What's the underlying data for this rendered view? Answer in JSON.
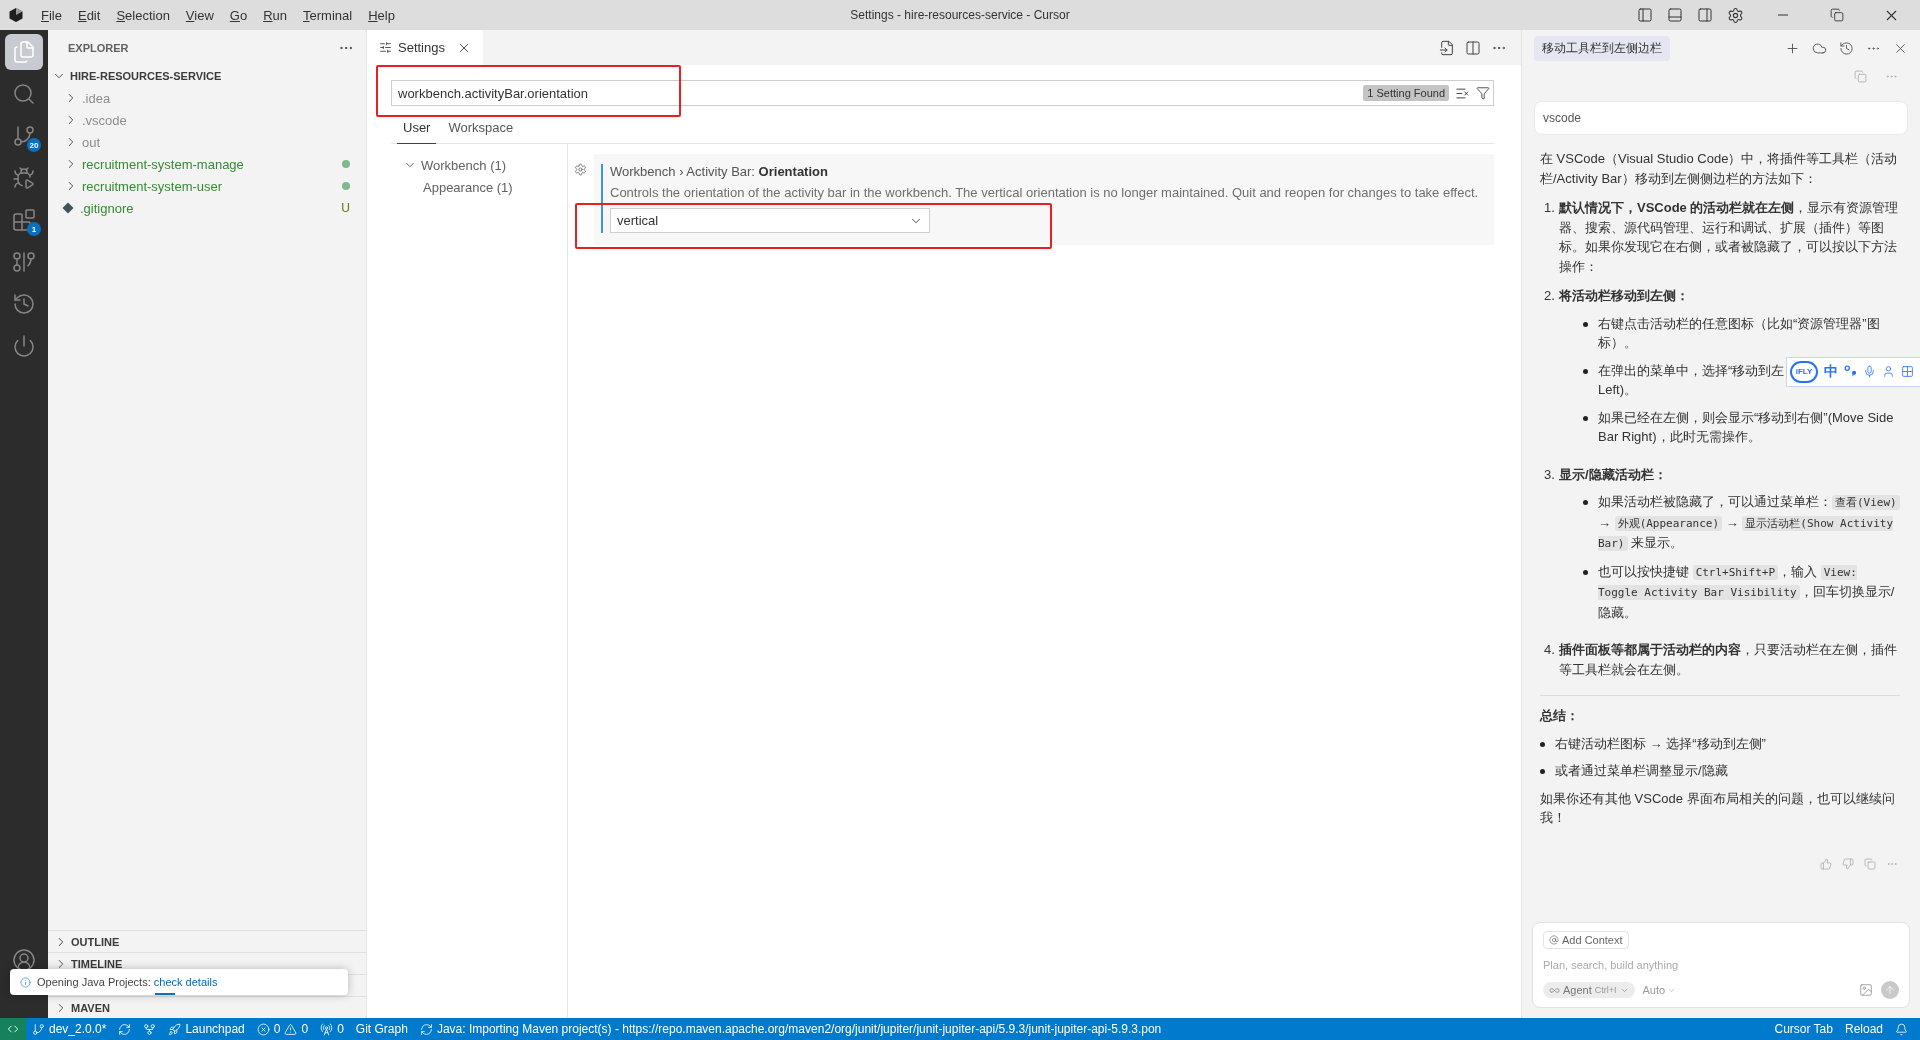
{
  "title_bar": {
    "menus": [
      "File",
      "Edit",
      "Selection",
      "View",
      "Go",
      "Run",
      "Terminal",
      "Help"
    ],
    "title": "Settings - hire-resources-service - Cursor"
  },
  "activity_bar": {
    "items": [
      {
        "kind": "explorer",
        "selected": true
      },
      {
        "kind": "search",
        "selected": false
      },
      {
        "kind": "source-control",
        "selected": false,
        "badge": "20"
      },
      {
        "kind": "run-debug",
        "selected": false
      },
      {
        "kind": "extensions",
        "selected": false,
        "badge": "1"
      },
      {
        "kind": "graph",
        "selected": false
      },
      {
        "kind": "history",
        "selected": false
      },
      {
        "kind": "power",
        "selected": false
      }
    ]
  },
  "explorer": {
    "title": "EXPLORER",
    "root": {
      "name": "HIRE-RESOURCES-SERVICE",
      "expanded": true,
      "children": [
        {
          "name": ".idea",
          "kind": "folder",
          "color": "#8e8e90",
          "expanded": false
        },
        {
          "name": ".vscode",
          "kind": "folder",
          "color": "#8e8e90",
          "expanded": false
        },
        {
          "name": "out",
          "kind": "folder",
          "color": "#8e8e90",
          "expanded": false
        },
        {
          "name": "recruitment-system-manage",
          "kind": "folder",
          "color": "#388a34",
          "expanded": false,
          "dot": true
        },
        {
          "name": "recruitment-system-user",
          "kind": "folder",
          "color": "#388a34",
          "expanded": false,
          "dot": true
        },
        {
          "name": ".gitignore",
          "kind": "file",
          "color": "#388a34",
          "badge": "U"
        }
      ]
    },
    "sections": [
      {
        "title": "OUTLINE",
        "expanded": false
      },
      {
        "title": "TIMELINE",
        "expanded": false
      },
      {
        "title": "MAVEN",
        "expanded": false
      }
    ]
  },
  "notification": {
    "message": "Opening Java Projects:",
    "link": "check details"
  },
  "editor": {
    "tabs": [
      {
        "label": "Settings",
        "selected": true
      }
    ],
    "settings": {
      "search_value": "workbench.activityBar.orientation",
      "result_count": "1 Setting Found",
      "scope_tabs": [
        {
          "label": "User",
          "selected": true
        },
        {
          "label": "Workspace",
          "selected": false
        }
      ],
      "toc": [
        {
          "label": "Workbench (1)",
          "expanded": true,
          "children": [
            {
              "label": "Appearance (1)"
            }
          ]
        }
      ],
      "setting": {
        "title": "Workbench › Activity Bar: **Orientation**",
        "description": "Controls the orientation of the activity bar in the workbench. The vertical orientation is no longer maintained. Quit and reopen for changes to take effect.",
        "value": "vertical"
      }
    }
  },
  "chat": {
    "title": "移动工具栏到左侧边栏",
    "user_message": "vscode",
    "answer": {
      "intro": "在 VSCode（Visual Studio Code）中，将插件等工具栏（活动栏/Activity Bar）移动到左侧侧边栏的方法如下：",
      "steps": [
        {
          "number": "1.",
          "text": "**默认情况下，VSCode 的活动栏就在左侧**，显示有资源管理器、搜索、源代码管理、运行和调试、扩展（插件）等图标。如果你发现它在右侧，或者被隐藏了，可以按以下方法操作："
        },
        {
          "number": "2.",
          "text": "**将活动栏移动到左侧：**",
          "bullets": [
            [
              {
                "kind": "text",
                "text": "右键点击活动栏的任意图标（比如“资源管理器”图标）。"
              }
            ],
            [
              {
                "kind": "text",
                "text": "在弹出的菜单中，选择“移动到左"
              },
              {
                "kind": "line",
                "text": "Left)。"
              }
            ],
            [
              {
                "kind": "text",
                "text": "如果已经在左侧，则会显示“移动到右侧”(Move Side Bar Right)，此时无需操作。"
              }
            ]
          ]
        },
        {
          "number": "3.",
          "text": "**显示/隐藏活动栏：**",
          "bullets": [
            [
              {
                "kind": "text",
                "text": "如果活动栏被隐藏了，可以通过菜单栏："
              },
              {
                "kind": "code",
                "text": "查看(View)"
              },
              {
                "kind": "text",
                "text": " → "
              },
              {
                "kind": "code",
                "text": "外观(Appearance)"
              },
              {
                "kind": "text",
                "text": " → "
              },
              {
                "kind": "code",
                "text": "显示活动栏(Show Activity Bar)"
              },
              {
                "kind": "text",
                "text": " 来显示。"
              }
            ],
            [
              {
                "kind": "text",
                "text": "也可以按快捷键 "
              },
              {
                "kind": "code",
                "text": "Ctrl+Shift+P"
              },
              {
                "kind": "text",
                "text": "，输入 "
              },
              {
                "kind": "code",
                "text": "View: Toggle Activity Bar Visibility"
              },
              {
                "kind": "text",
                "text": "，回车切换显示/隐藏。"
              }
            ]
          ]
        },
        {
          "number": "4.",
          "text": "**插件面板等都属于活动栏的内容**，只要活动栏在左侧，插件等工具栏就会在左侧。"
        }
      ],
      "summary_title": "总结：",
      "summary": [
        "右键活动栏图标 → 选择“移动到左侧”",
        "或者通过菜单栏调整显示/隐藏"
      ],
      "closing": "如果你还有其他 VSCode 界面布局相关的问题，也可以继续问我！"
    },
    "input": {
      "context_label": "Add Context",
      "placeholder": "Plan, search, build anything",
      "mode": "Agent",
      "mode_shortcut": "Ctrl+I",
      "model": "Auto"
    }
  },
  "ime_toolbar": {
    "logo": "iFLY",
    "language": "中"
  },
  "status_bar": {
    "left": [
      {
        "kind": "remote"
      },
      {
        "kind": "branch",
        "text": "dev_2.0.0*"
      },
      {
        "kind": "sync"
      },
      {
        "kind": "fork"
      },
      {
        "kind": "rocket",
        "text": "Launchpad"
      },
      {
        "kind": "problems",
        "errors": "0",
        "warnings": "0"
      },
      {
        "kind": "ports",
        "text": "0"
      },
      {
        "kind": "plain",
        "text": "Git Graph"
      },
      {
        "kind": "sync",
        "text": "Java: Importing Maven project(s) - https://repo.maven.apache.org/maven2/org/junit/jupiter/junit-jupiter-api/5.9.3/junit-jupiter-api-5.9.3.pon"
      }
    ],
    "right": [
      {
        "kind": "plain",
        "text": "Cursor Tab"
      },
      {
        "kind": "plain",
        "text": "Reload"
      },
      {
        "kind": "bell"
      }
    ]
  }
}
